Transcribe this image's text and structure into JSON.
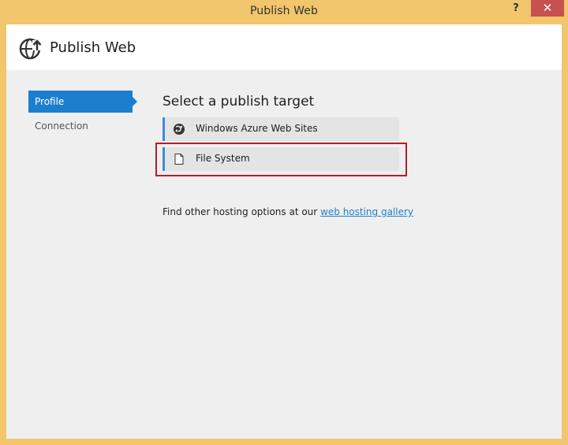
{
  "window": {
    "title": "Publish Web",
    "help_label": "?",
    "close_label": "✕"
  },
  "header": {
    "title": "Publish Web",
    "icon": "globe-upload-icon"
  },
  "sidebar": {
    "items": [
      {
        "label": "Profile",
        "active": true
      },
      {
        "label": "Connection",
        "active": false
      }
    ]
  },
  "main": {
    "section_title": "Select a publish target",
    "targets": [
      {
        "label": "Windows Azure Web Sites",
        "icon": "azure-logo-icon"
      },
      {
        "label": "File System",
        "icon": "document-icon",
        "highlighted": true
      }
    ],
    "hosting_text": "Find other hosting options at our",
    "hosting_link": "web hosting gallery"
  },
  "colors": {
    "title_bar": "#f1c66c",
    "accent": "#1c7fce",
    "close_button": "#c75050",
    "highlight_border": "#b01e2a"
  }
}
